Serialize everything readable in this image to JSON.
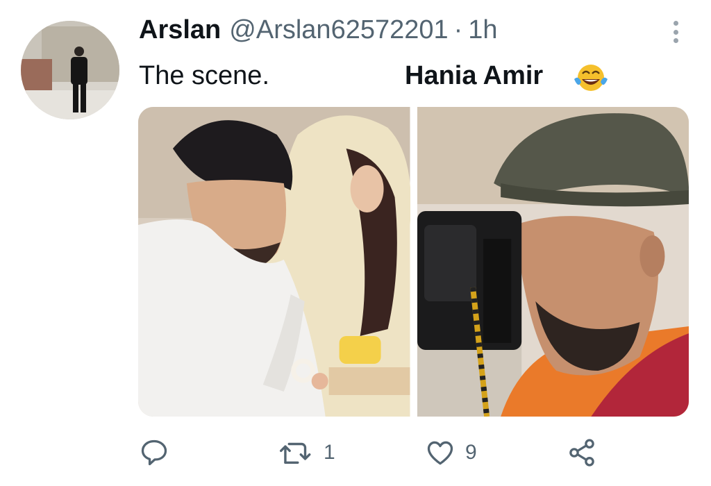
{
  "tweet": {
    "display_name": "Arslan",
    "handle": "@Arslan62572201",
    "separator": "·",
    "time": "1h",
    "text_part1": "The scene.",
    "text_part2": "Hania Amir",
    "emoji": "face-with-tears-of-joy"
  },
  "actions": {
    "reply": {
      "icon": "reply-icon"
    },
    "retweet": {
      "icon": "retweet-icon",
      "count": "1"
    },
    "like": {
      "icon": "heart-icon",
      "count": "9"
    },
    "share": {
      "icon": "share-icon"
    }
  },
  "colors": {
    "text": "#0f1419",
    "secondary": "#536471",
    "icon": "#536471",
    "background": "#ffffff"
  }
}
